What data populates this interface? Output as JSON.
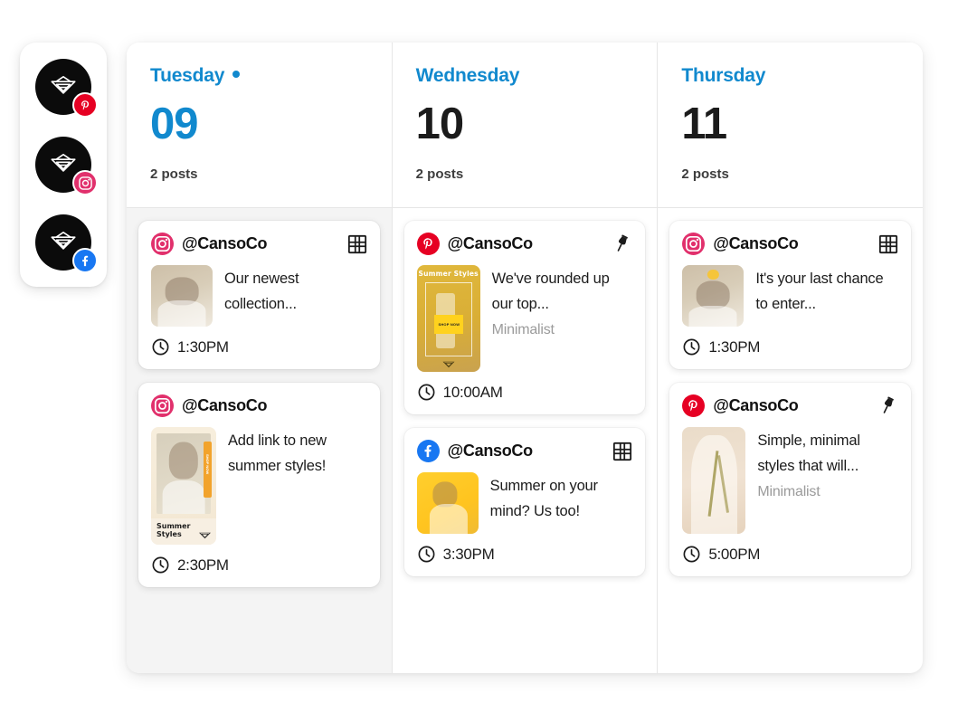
{
  "accounts": [
    {
      "name": "canso-co-pinterest",
      "network": "pinterest",
      "badge_color": "#E60023",
      "avatar_color": "#0b0b0b"
    },
    {
      "name": "canso-co-instagram",
      "network": "instagram",
      "badge_color": "#E1306C",
      "avatar_color": "#0b0b0b"
    },
    {
      "name": "canso-co-facebook",
      "network": "facebook",
      "badge_color": "#1877F2",
      "avatar_color": "#0b0b0b"
    }
  ],
  "colors": {
    "accent_blue": "#1189ce",
    "instagram": "#E1306C",
    "pinterest": "#E60023",
    "facebook": "#1877F2",
    "today_bg": "#f4f4f4"
  },
  "columns": [
    {
      "day_name": "Tuesday",
      "day_number": "09",
      "post_count": "2 posts",
      "is_today": true,
      "posts": [
        {
          "network": "instagram",
          "handle": "@CansoCo",
          "type_icon": "grid-icon",
          "caption": "Our newest collection...",
          "board": "",
          "time": "1:30PM",
          "thumb": "woman-beige-portrait",
          "thumb_shape": "sq"
        },
        {
          "network": "instagram",
          "handle": "@CansoCo",
          "type_icon": "",
          "caption": "Add link to new summer styles!",
          "board": "",
          "time": "2:30PM",
          "thumb": "summer-styles-card",
          "thumb_shape": "tall",
          "thumb_title": "Summer Styles",
          "thumb_strip_text": "SHOP NOW"
        }
      ]
    },
    {
      "day_name": "Wednesday",
      "day_number": "10",
      "post_count": "2 posts",
      "is_today": false,
      "posts": [
        {
          "network": "pinterest",
          "handle": "@CansoCo",
          "type_icon": "pin-icon",
          "caption": "We've rounded up our top...",
          "board": "Minimalist",
          "time": "10:00AM",
          "thumb": "summer-styles-gold-pin",
          "thumb_shape": "pin",
          "thumb_title": "Summer Styles",
          "thumb_strip_text": "SHOP NOW"
        },
        {
          "network": "facebook",
          "handle": "@CansoCo",
          "type_icon": "grid-icon",
          "caption": "Summer on your mind? Us too!",
          "board": "",
          "time": "3:30PM",
          "thumb": "woman-yellow-background",
          "thumb_shape": "sq"
        }
      ]
    },
    {
      "day_name": "Thursday",
      "day_number": "11",
      "post_count": "2 posts",
      "is_today": false,
      "posts": [
        {
          "network": "instagram",
          "handle": "@CansoCo",
          "type_icon": "grid-icon",
          "caption": "It's your last chance to enter...",
          "board": "",
          "time": "1:30PM",
          "thumb": "woman-arms-up",
          "thumb_shape": "sq"
        },
        {
          "network": "pinterest",
          "handle": "@CansoCo",
          "type_icon": "pin-icon",
          "caption": "Simple, minimal styles that will...",
          "board": "Minimalist",
          "time": "5:00PM",
          "thumb": "dried-flowers-dress",
          "thumb_shape": "pin"
        }
      ]
    }
  ]
}
